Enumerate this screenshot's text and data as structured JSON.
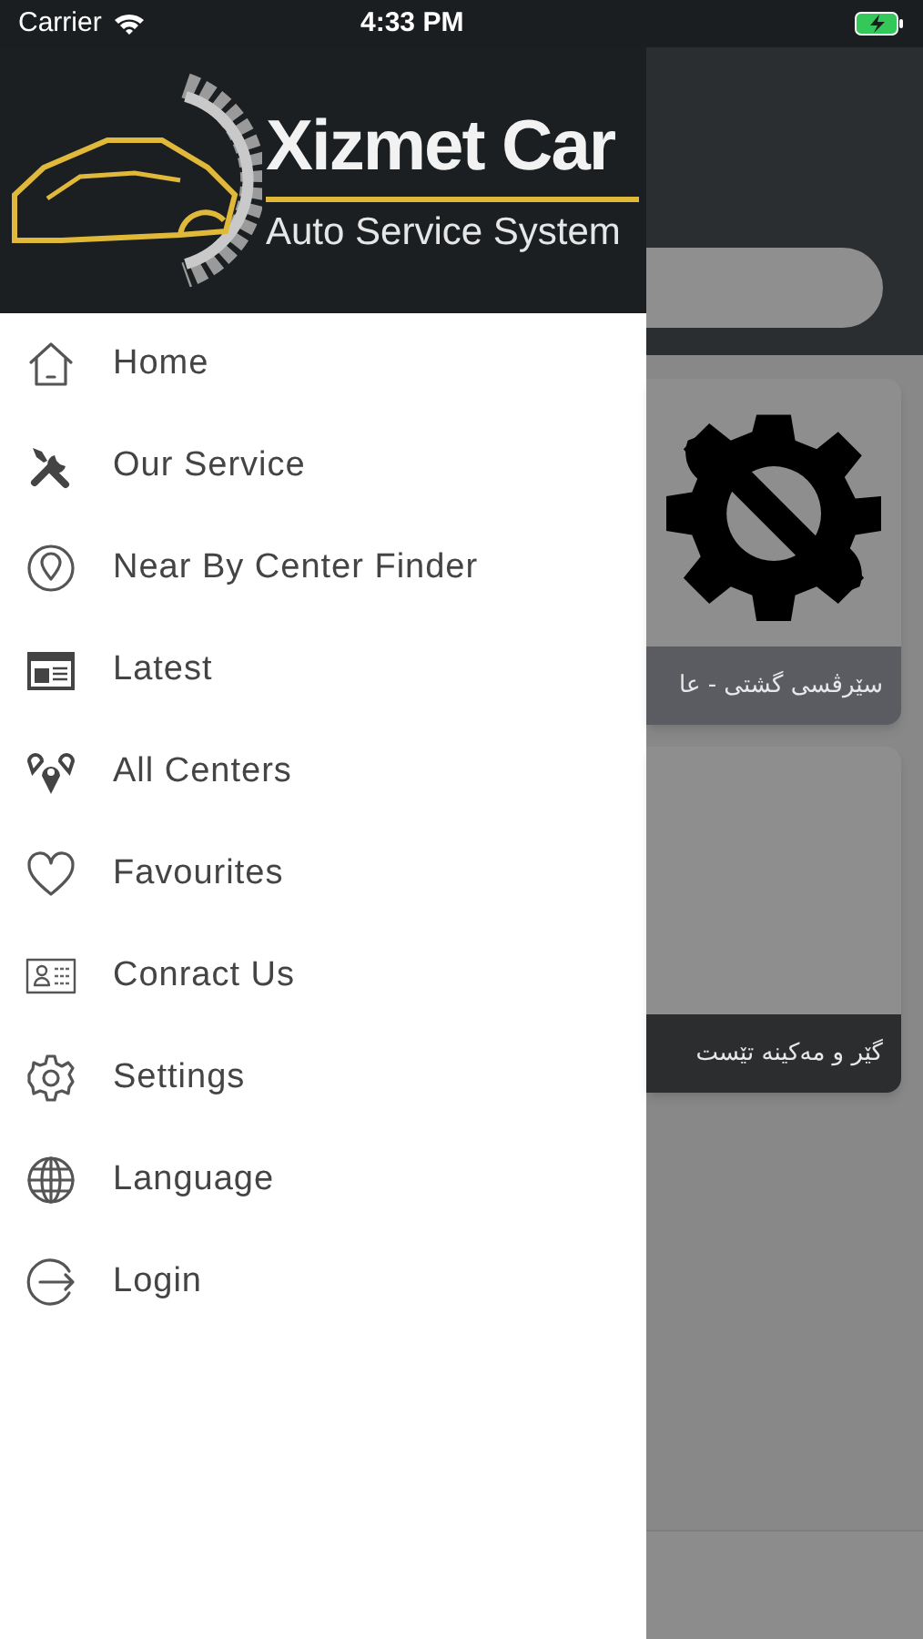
{
  "status_bar": {
    "carrier": "Carrier",
    "time": "4:33 PM"
  },
  "drawer": {
    "logo": {
      "title": "Xizmet Car",
      "subtitle": "Auto Service System"
    },
    "items": [
      {
        "label": "Home"
      },
      {
        "label": "Our Service"
      },
      {
        "label": "Near By Center Finder"
      },
      {
        "label": "Latest"
      },
      {
        "label": "All Centers"
      },
      {
        "label": "Favourites"
      },
      {
        "label": "Conract Us"
      },
      {
        "label": "Settings"
      },
      {
        "label": "Language"
      },
      {
        "label": "Login"
      }
    ]
  },
  "cards": [
    {
      "caption": "سێرڤسی گشتی - عا",
      "kind": "icon"
    },
    {
      "caption": "گێر و مەکینە تێست",
      "kind": "blank"
    }
  ]
}
